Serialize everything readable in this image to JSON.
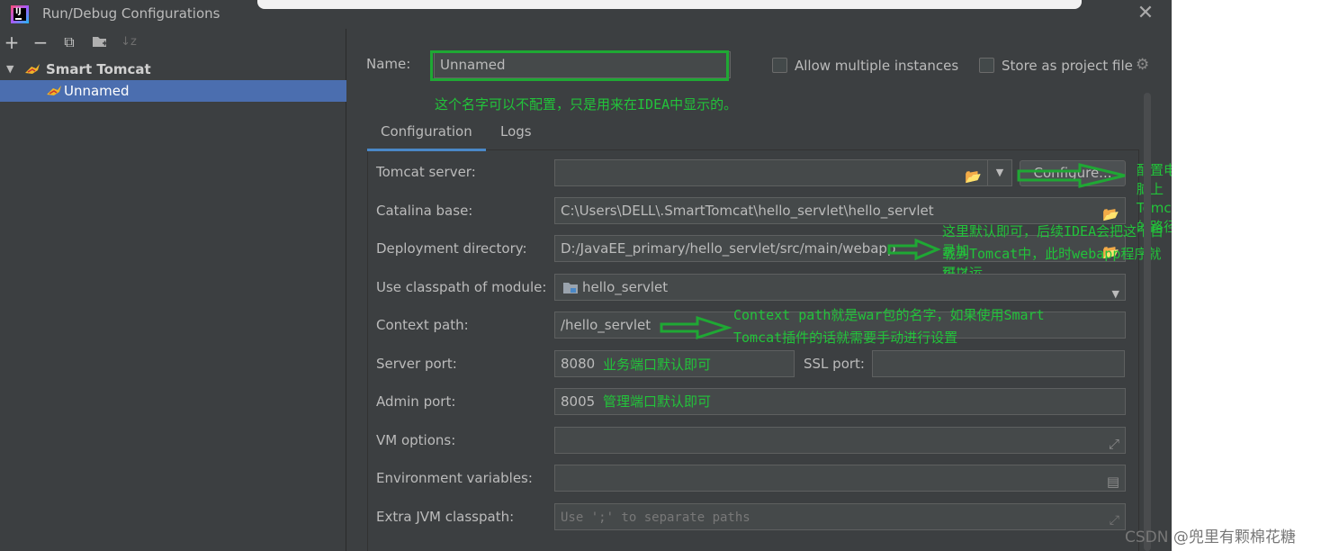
{
  "window": {
    "title": "Run/Debug Configurations",
    "app_icon_text": "IJ",
    "close_label": "✕"
  },
  "toolbar": {
    "add": "+",
    "remove": "−",
    "copy": "⧉",
    "folder": "📁",
    "sort": "↓z"
  },
  "tree": {
    "group_label": "Smart Tomcat",
    "item_label": "Unnamed"
  },
  "name_field": {
    "label": "Name:",
    "value": "Unnamed"
  },
  "options": {
    "allow_multiple": "Allow multiple instances",
    "store_as_project": "Store as project file"
  },
  "tabs": [
    {
      "label": "Configuration",
      "active": true
    },
    {
      "label": "Logs",
      "active": false
    }
  ],
  "form": {
    "tomcat_server": {
      "label": "Tomcat server:",
      "value": "",
      "button": "Configure..."
    },
    "catalina_base": {
      "label": "Catalina base:",
      "value": "C:\\Users\\DELL\\.SmartTomcat\\hello_servlet\\hello_servlet"
    },
    "deployment_directory": {
      "label": "Deployment directory:",
      "value": "D:/JavaEE_primary/hello_servlet/src/main/webapp"
    },
    "classpath_module": {
      "label": "Use classpath of module:",
      "value": "hello_servlet"
    },
    "context_path": {
      "label": "Context path:",
      "value": "/hello_servlet"
    },
    "server_port": {
      "label": "Server port:",
      "value": "8080"
    },
    "ssl_port": {
      "label": "SSL port:",
      "value": ""
    },
    "admin_port": {
      "label": "Admin port:",
      "value": "8005"
    },
    "vm_options": {
      "label": "VM options:",
      "value": ""
    },
    "env_vars": {
      "label": "Environment variables:",
      "value": ""
    },
    "extra_jvm": {
      "label": "Extra JVM classpath:",
      "placeholder": "Use ';' to separate paths"
    }
  },
  "annotations": {
    "name_note": "这个名字可以不配置，只是用来在IDEA中显示的。",
    "tomcat_note": "配置电脑上Tomcat的路径",
    "deploy_note_1": "这里默认即可，后续IDEA会把这个目录加",
    "deploy_note_2": "载到Tomcat中，此时webapp程序就可以运",
    "deploy_note_3": "行了",
    "context_note_1": "Context path就是war包的名字，如果使用Smart",
    "context_note_2": "Tomcat插件的话就需要手动进行设置",
    "server_port_note": "业务端口默认即可",
    "admin_port_note": "管理端口默认即可"
  },
  "watermark": "CSDN @兜里有颗棉花糖",
  "colors": {
    "background": "#3c3f41",
    "selection": "#4b6eaf",
    "annotation_green": "#22c33a",
    "tab_accent": "#4a88c7"
  }
}
